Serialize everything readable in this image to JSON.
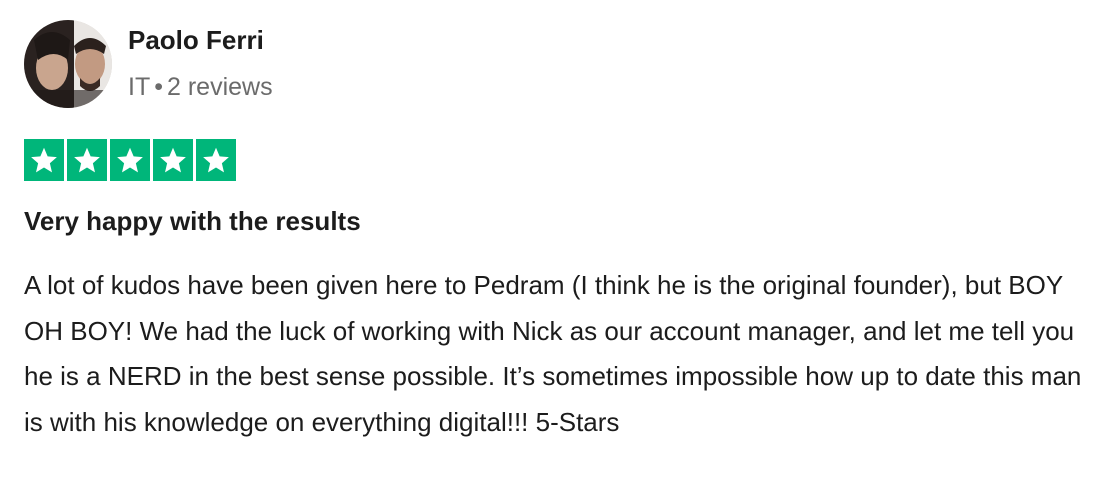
{
  "reviewer": {
    "name": "Paolo Ferri",
    "country": "IT",
    "separator": "•",
    "reviews_count": "2 reviews"
  },
  "rating": {
    "stars": 5,
    "max_stars": 5,
    "color": "#00b67a",
    "icon": "star-icon"
  },
  "review": {
    "title": "Very happy with the results",
    "body": "A lot of kudos have been given here to Pedram (I think he is the original founder), but BOY OH BOY! We had the luck of working with Nick as our account manager, and let me tell you he is a NERD in the best sense possible. It’s sometimes impossible how up to date this man is with his knowledge on everything digital!!! 5-Stars"
  }
}
